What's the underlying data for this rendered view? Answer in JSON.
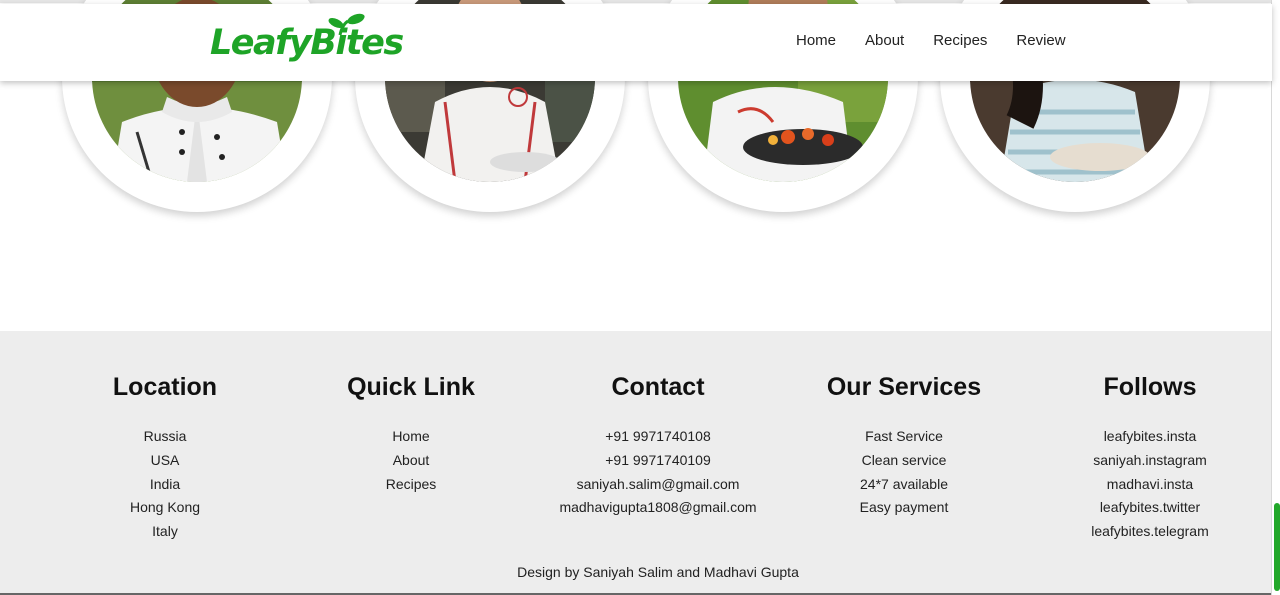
{
  "brand": {
    "logo_text": "LeafyBites",
    "accent": "#1ea427"
  },
  "nav": {
    "items": [
      "Home",
      "About",
      "Recipes",
      "Review"
    ]
  },
  "chefs": [
    "chef-1",
    "chef-2",
    "chef-3",
    "chef-4"
  ],
  "footer": {
    "columns": [
      {
        "title": "Location",
        "items": [
          "Russia",
          "USA",
          "India",
          "Hong Kong",
          "Italy"
        ]
      },
      {
        "title": "Quick Link",
        "items": [
          "Home",
          "About",
          "Recipes"
        ]
      },
      {
        "title": "Contact",
        "items": [
          "+91 9971740108",
          "+91 9971740109",
          "saniyah.salim@gmail.com",
          "madhavigupta1808@gmail.com"
        ]
      },
      {
        "title": "Our Services",
        "items": [
          "Fast Service",
          "Clean service",
          "24*7 available",
          "Easy payment"
        ]
      },
      {
        "title": "Follows",
        "items": [
          "leafybites.insta",
          "saniyah.instagram",
          "madhavi.insta",
          "leafybites.twitter",
          "leafybites.telegram"
        ]
      }
    ],
    "credit": "Design by  Saniyah Salim and Madhavi Gupta"
  }
}
